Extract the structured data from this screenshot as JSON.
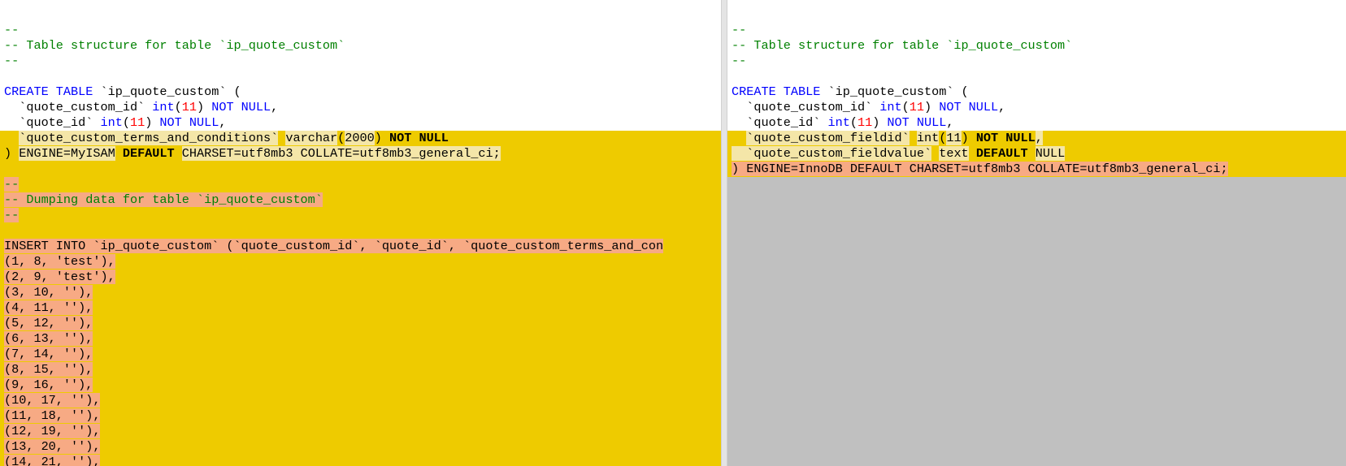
{
  "colors": {
    "changed_background": "#eecb00",
    "removed_text_highlight": "#f7aa84",
    "modified_text_highlight": "#f4e6a8",
    "missing_lines_fill": "#c0c0c0",
    "keyword": "#0000ff",
    "number": "#ff0000",
    "comment": "#008000"
  },
  "left_pane": {
    "lines": [
      {
        "changed": false,
        "tokens": [
          {
            "t": "-- ---------------------------------------------------------",
            "c": "cm"
          }
        ]
      },
      {
        "changed": false,
        "tokens": []
      },
      {
        "changed": false,
        "tokens": [
          {
            "t": "--",
            "c": "cm"
          }
        ]
      },
      {
        "changed": false,
        "tokens": [
          {
            "t": "-- Table structure for table `ip_quote_custom`",
            "c": "cm"
          }
        ]
      },
      {
        "changed": false,
        "tokens": [
          {
            "t": "--",
            "c": "cm"
          }
        ]
      },
      {
        "changed": false,
        "tokens": []
      },
      {
        "changed": false,
        "tokens": [
          {
            "t": "CREATE TABLE",
            "c": "kw"
          },
          {
            "t": " `ip_quote_custom` (",
            "c": "txt"
          }
        ]
      },
      {
        "changed": false,
        "tokens": [
          {
            "t": "  `quote_custom_id` ",
            "c": "txt"
          },
          {
            "t": "int",
            "c": "kw"
          },
          {
            "t": "(",
            "c": "txt"
          },
          {
            "t": "11",
            "c": "num"
          },
          {
            "t": ") ",
            "c": "txt"
          },
          {
            "t": "NOT NULL",
            "c": "kw"
          },
          {
            "t": ",",
            "c": "txt"
          }
        ]
      },
      {
        "changed": false,
        "tokens": [
          {
            "t": "  `quote_id` ",
            "c": "txt"
          },
          {
            "t": "int",
            "c": "kw"
          },
          {
            "t": "(",
            "c": "txt"
          },
          {
            "t": "11",
            "c": "num"
          },
          {
            "t": ") ",
            "c": "txt"
          },
          {
            "t": "NOT NULL",
            "c": "kw"
          },
          {
            "t": ",",
            "c": "txt"
          }
        ]
      },
      {
        "changed": true,
        "tokens": [
          {
            "t": "  ",
            "c": "y txt"
          },
          {
            "t": "`quote_custom_terms_and_conditions`",
            "c": "t txt"
          },
          {
            "t": " ",
            "c": "y txt"
          },
          {
            "t": "varchar",
            "c": "t txt"
          },
          {
            "t": "(",
            "c": "y txt"
          },
          {
            "t": "2000",
            "c": "t txt"
          },
          {
            "t": ") ",
            "c": "y txt"
          },
          {
            "t": "NOT NULL",
            "c": "y kwb"
          }
        ]
      },
      {
        "changed": true,
        "tokens": [
          {
            "t": ") ",
            "c": "y txt"
          },
          {
            "t": "ENGINE=MyISAM",
            "c": "t txt"
          },
          {
            "t": " ",
            "c": "y txt"
          },
          {
            "t": "DEFAULT",
            "c": "y kwb"
          },
          {
            "t": " ",
            "c": "y txt"
          },
          {
            "t": "CHARSET=utf8mb3 COLLATE=utf8mb3_general_ci;",
            "c": "t txt"
          }
        ]
      },
      {
        "changed": true,
        "tokens": []
      },
      {
        "changed": true,
        "tokens": [
          {
            "t": "--",
            "c": "p cm"
          }
        ]
      },
      {
        "changed": true,
        "tokens": [
          {
            "t": "-- Dumping data for table `ip_quote_custom`",
            "c": "p cm"
          }
        ]
      },
      {
        "changed": true,
        "tokens": [
          {
            "t": "--",
            "c": "p cm"
          }
        ]
      },
      {
        "changed": true,
        "tokens": []
      },
      {
        "changed": true,
        "tokens": [
          {
            "t": "INSERT INTO `ip_quote_custom` (`quote_custom_id`, `quote_id`, `quote_custom_terms_and_con",
            "c": "p txt"
          }
        ]
      },
      {
        "changed": true,
        "tokens": [
          {
            "t": "(1, 8, 'test'),",
            "c": "p txt"
          }
        ]
      },
      {
        "changed": true,
        "tokens": [
          {
            "t": "(2, 9, 'test'),",
            "c": "p txt"
          }
        ]
      },
      {
        "changed": true,
        "tokens": [
          {
            "t": "(3, 10, ''),",
            "c": "p txt"
          }
        ]
      },
      {
        "changed": true,
        "tokens": [
          {
            "t": "(4, 11, ''),",
            "c": "p txt"
          }
        ]
      },
      {
        "changed": true,
        "tokens": [
          {
            "t": "(5, 12, ''),",
            "c": "p txt"
          }
        ]
      },
      {
        "changed": true,
        "tokens": [
          {
            "t": "(6, 13, ''),",
            "c": "p txt"
          }
        ]
      },
      {
        "changed": true,
        "tokens": [
          {
            "t": "(7, 14, ''),",
            "c": "p txt"
          }
        ]
      },
      {
        "changed": true,
        "tokens": [
          {
            "t": "(8, 15, ''),",
            "c": "p txt"
          }
        ]
      },
      {
        "changed": true,
        "tokens": [
          {
            "t": "(9, 16, ''),",
            "c": "p txt"
          }
        ]
      },
      {
        "changed": true,
        "tokens": [
          {
            "t": "(10, 17, ''),",
            "c": "p txt"
          }
        ]
      },
      {
        "changed": true,
        "tokens": [
          {
            "t": "(11, 18, ''),",
            "c": "p txt"
          }
        ]
      },
      {
        "changed": true,
        "tokens": [
          {
            "t": "(12, 19, ''),",
            "c": "p txt"
          }
        ]
      },
      {
        "changed": true,
        "tokens": [
          {
            "t": "(13, 20, ''),",
            "c": "p txt"
          }
        ]
      },
      {
        "changed": true,
        "tokens": [
          {
            "t": "(14, 21, ''),",
            "c": "p txt"
          }
        ]
      }
    ]
  },
  "right_pane": {
    "lines": [
      {
        "changed": false,
        "tokens": [
          {
            "t": "-- ---------------------------------------------------------",
            "c": "cm"
          }
        ]
      },
      {
        "changed": false,
        "tokens": []
      },
      {
        "changed": false,
        "tokens": [
          {
            "t": "--",
            "c": "cm"
          }
        ]
      },
      {
        "changed": false,
        "tokens": [
          {
            "t": "-- Table structure for table `ip_quote_custom`",
            "c": "cm"
          }
        ]
      },
      {
        "changed": false,
        "tokens": [
          {
            "t": "--",
            "c": "cm"
          }
        ]
      },
      {
        "changed": false,
        "tokens": []
      },
      {
        "changed": false,
        "tokens": [
          {
            "t": "CREATE TABLE",
            "c": "kw"
          },
          {
            "t": " `ip_quote_custom` (",
            "c": "txt"
          }
        ]
      },
      {
        "changed": false,
        "tokens": [
          {
            "t": "  `quote_custom_id` ",
            "c": "txt"
          },
          {
            "t": "int",
            "c": "kw"
          },
          {
            "t": "(",
            "c": "txt"
          },
          {
            "t": "11",
            "c": "num"
          },
          {
            "t": ") ",
            "c": "txt"
          },
          {
            "t": "NOT NULL",
            "c": "kw"
          },
          {
            "t": ",",
            "c": "txt"
          }
        ]
      },
      {
        "changed": false,
        "tokens": [
          {
            "t": "  `quote_id` ",
            "c": "txt"
          },
          {
            "t": "int",
            "c": "kw"
          },
          {
            "t": "(",
            "c": "txt"
          },
          {
            "t": "11",
            "c": "num"
          },
          {
            "t": ") ",
            "c": "txt"
          },
          {
            "t": "NOT NULL",
            "c": "kw"
          },
          {
            "t": ",",
            "c": "txt"
          }
        ]
      },
      {
        "changed": true,
        "tokens": [
          {
            "t": "  ",
            "c": "y txt"
          },
          {
            "t": "`quote_custom_fieldid`",
            "c": "t txt"
          },
          {
            "t": " ",
            "c": "y txt"
          },
          {
            "t": "int",
            "c": "t txt"
          },
          {
            "t": "(",
            "c": "y txt"
          },
          {
            "t": "11",
            "c": "t txt"
          },
          {
            "t": ") ",
            "c": "y txt"
          },
          {
            "t": "NOT NULL",
            "c": "y kwb"
          },
          {
            "t": ",",
            "c": "t txt"
          }
        ]
      },
      {
        "changed": true,
        "tokens": [
          {
            "t": "  ",
            "c": "t txt"
          },
          {
            "t": "`quote_custom_fieldvalue`",
            "c": "t txt"
          },
          {
            "t": " ",
            "c": "y txt"
          },
          {
            "t": "text",
            "c": "t txt"
          },
          {
            "t": " ",
            "c": "y txt"
          },
          {
            "t": "DEFAULT",
            "c": "y kwb"
          },
          {
            "t": " ",
            "c": "y txt"
          },
          {
            "t": "NULL",
            "c": "t txt"
          }
        ]
      },
      {
        "changed": true,
        "tokens": [
          {
            "t": ") ENGINE=InnoDB DEFAULT CHARSET=utf8mb3 COLLATE=utf8mb3_general_ci;",
            "c": "p txt"
          }
        ]
      }
    ]
  }
}
